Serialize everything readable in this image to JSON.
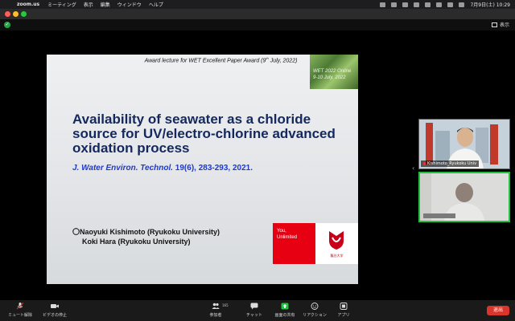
{
  "menubar": {
    "app": "zoom.us",
    "items": [
      "ミーティング",
      "表示",
      "編集",
      "ウィンドウ",
      "ヘルプ"
    ],
    "clock": "7月9日(土) 10:29"
  },
  "info_bar": {
    "view_label": "表示"
  },
  "slide": {
    "award": "Award lecture for WET Excellent Paper Award (9",
    "award_sup": "th",
    "award_end": " July, 2022)",
    "forest_line1": "WET 2022 Online",
    "forest_line2": "9-10 July, 2022",
    "title": "Availability of seawater as a chloride source for UV/electro-chlorine advanced oxidation process",
    "journal_name": "J. Water Environ. Technol.",
    "journal_ref": " 19(6), 283-293, 2021.",
    "author1": "〇Naoyuki Kishimoto (Ryukoku University)",
    "author2": "Koki Hara (Ryukoku University)",
    "logo_line1": "You,",
    "logo_line2": "Unlimited",
    "university": "龍谷大学"
  },
  "participants": [
    {
      "name": "Kishimoto_Ryukoku Univ"
    },
    {
      "name": ""
    }
  ],
  "toolbar": {
    "mute": "ミュート解除",
    "video": "ビデオの停止",
    "participants": "参加者",
    "participant_count": "165",
    "chat": "チャット",
    "share": "画面の共有",
    "reactions": "リアクション",
    "apps": "アプリ",
    "end": "退出"
  },
  "colors": {
    "share_green": "#22c241",
    "end_red": "#d9352a",
    "title_navy": "#14285e",
    "journal_blue": "#1d39cc"
  }
}
